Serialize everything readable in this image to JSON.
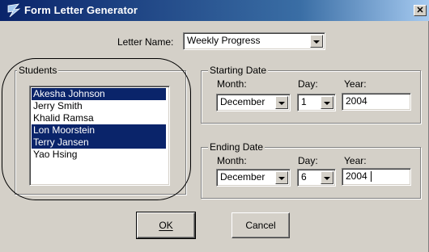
{
  "window": {
    "title": "Form Letter Generator",
    "close_glyph": "✕"
  },
  "letter": {
    "label": "Letter Name:",
    "value": "Weekly Progress"
  },
  "students": {
    "legend": "Students",
    "items": [
      {
        "name": "Akesha Johnson",
        "selected": true
      },
      {
        "name": "Jerry Smith",
        "selected": false
      },
      {
        "name": "Khalid Ramsa",
        "selected": false
      },
      {
        "name": "Lon Moorstein",
        "selected": true
      },
      {
        "name": "Terry Jansen",
        "selected": true
      },
      {
        "name": "Yao Hsing",
        "selected": false
      }
    ]
  },
  "starting_date": {
    "legend": "Starting Date",
    "month_label": "Month:",
    "day_label": "Day:",
    "year_label": "Year:",
    "month": "December",
    "day": "1",
    "year": "2004"
  },
  "ending_date": {
    "legend": "Ending Date",
    "month_label": "Month:",
    "day_label": "Day:",
    "year_label": "Year:",
    "month": "December",
    "day": "6",
    "year": "2004"
  },
  "buttons": {
    "ok": "OK",
    "cancel": "Cancel"
  },
  "colors": {
    "title_start": "#0a246a",
    "selection": "#0a246a",
    "face": "#d4d0c8"
  }
}
